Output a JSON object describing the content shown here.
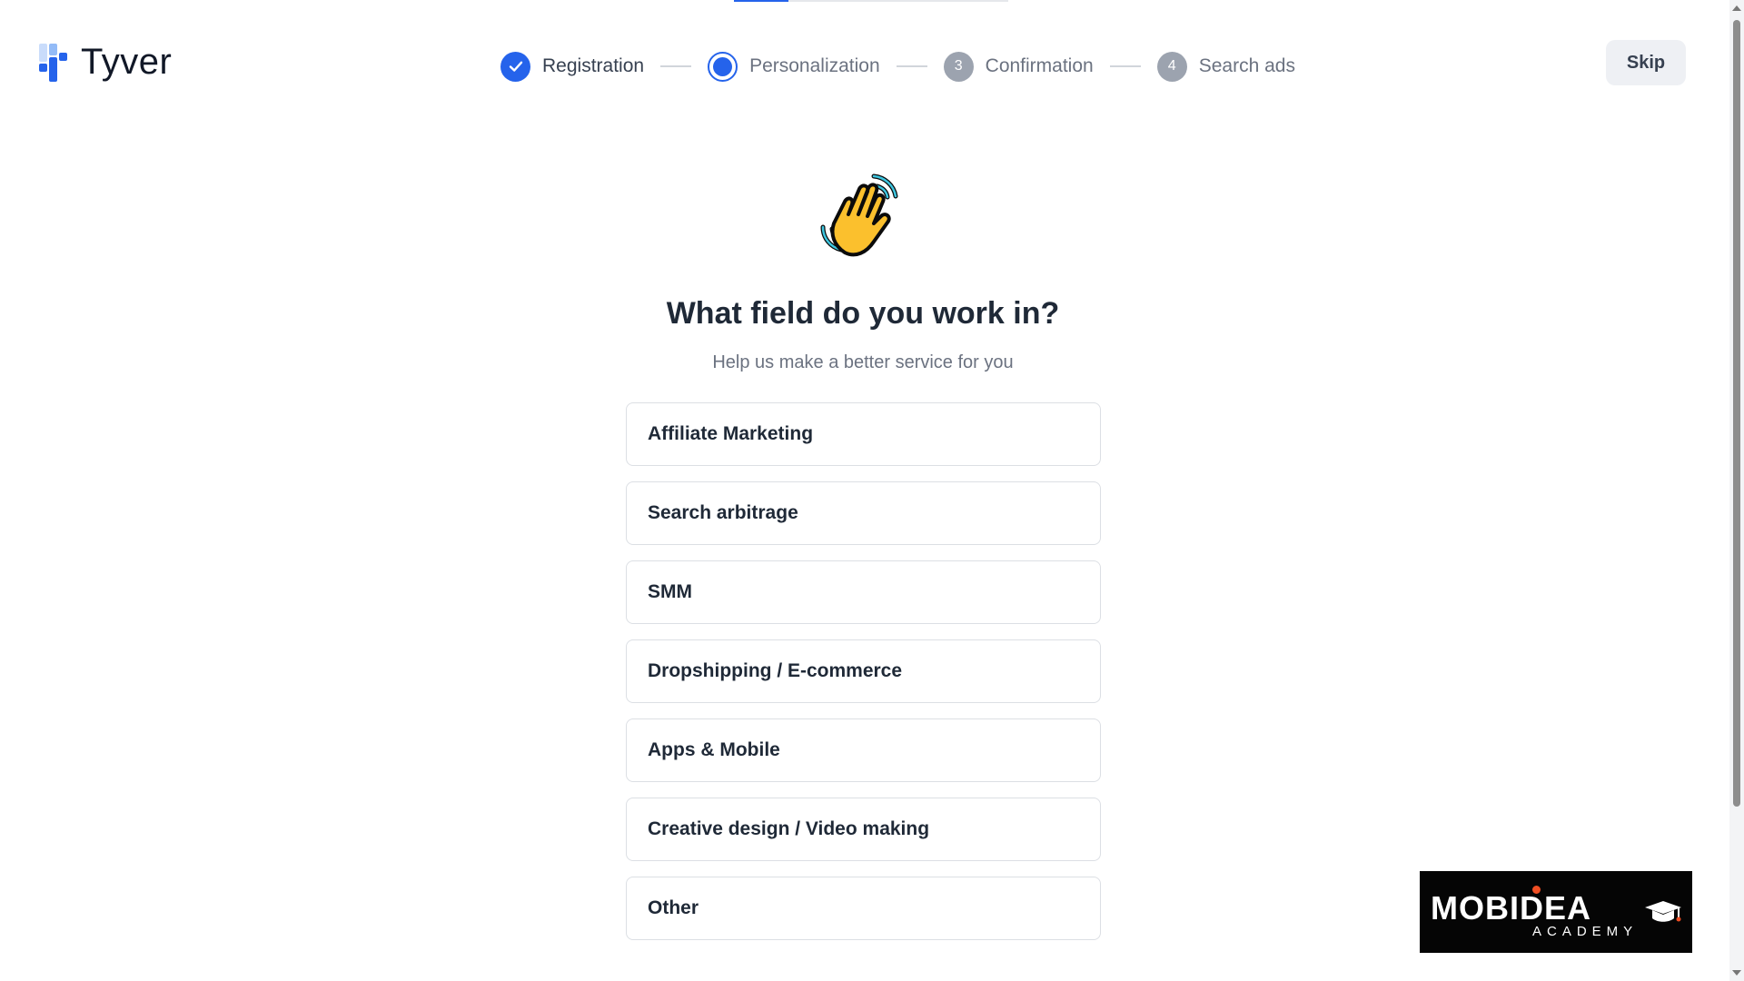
{
  "brand": {
    "name": "Tyver",
    "accent": "#2563eb"
  },
  "progress": {
    "fraction": 0.2
  },
  "stepper": {
    "steps": [
      {
        "label": "Registration",
        "state": "done",
        "number": ""
      },
      {
        "label": "Personalization",
        "state": "active",
        "number": ""
      },
      {
        "label": "Confirmation",
        "state": "pending",
        "number": "3"
      },
      {
        "label": "Search ads",
        "state": "pending",
        "number": "4"
      }
    ]
  },
  "header": {
    "skip_label": "Skip"
  },
  "main": {
    "emoji": "waving-hand-icon",
    "title": "What field do you work in?",
    "subtitle": "Help us make a better service for you",
    "options": [
      "Affiliate Marketing",
      "Search arbitrage",
      "SMM",
      "Dropshipping / E-commerce",
      "Apps & Mobile",
      "Creative design / Video making",
      "Other"
    ]
  },
  "watermark": {
    "title": "MOBIDEA",
    "subtitle": "ACADEMY"
  }
}
